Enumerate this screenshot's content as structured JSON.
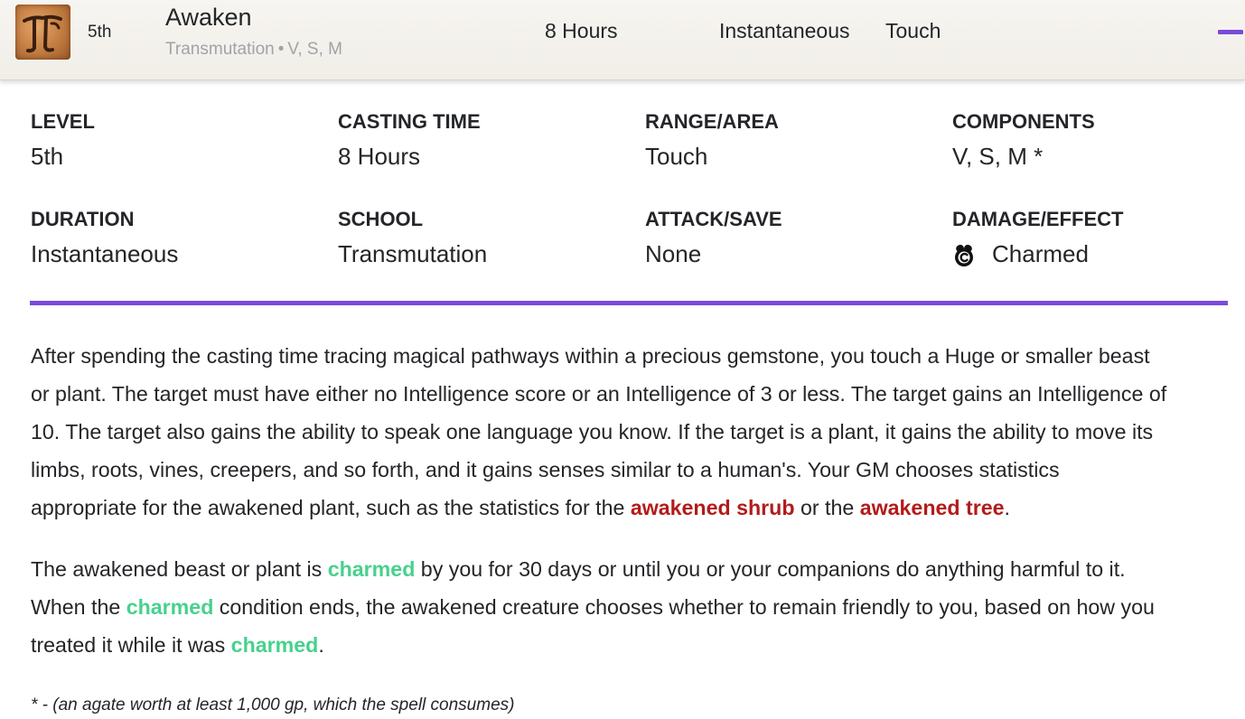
{
  "header": {
    "icon": "transmutation-school-icon",
    "level": "5th",
    "name": "Awaken",
    "school": "Transmutation",
    "separator": "•",
    "components": "V, S, M",
    "casting_time": "8 Hours",
    "duration": "Instantaneous",
    "range": "Touch",
    "accent_color": "#7a4bdb"
  },
  "stats": {
    "level": {
      "label": "LEVEL",
      "value": "5th"
    },
    "casting_time": {
      "label": "CASTING TIME",
      "value": "8 Hours"
    },
    "range": {
      "label": "RANGE/AREA",
      "value": "Touch"
    },
    "components": {
      "label": "COMPONENTS",
      "value": "V, S, M *"
    },
    "duration": {
      "label": "DURATION",
      "value": "Instantaneous"
    },
    "school": {
      "label": "SCHOOL",
      "value": "Transmutation"
    },
    "attack": {
      "label": "ATTACK/SAVE",
      "value": "None"
    },
    "damage": {
      "label": "DAMAGE/EFFECT",
      "value": "Charmed",
      "icon": "charmed-condition-icon"
    }
  },
  "description": {
    "p1": {
      "l1": "After spending the casting time tracing magical pathways within a precious gemstone, you touch a Huge or smaller beast",
      "l2": "or plant. The target must have either no Intelligence score or an Intelligence of 3 or less. The target gains an Intelligence of",
      "l3": "10. The target also gains the ability to speak one language you know. If the target is a plant, it gains the ability to move its",
      "l4": "limbs, roots, vines, creepers, and so forth, and it gains senses similar to a human's. Your GM chooses statistics",
      "l5a": "appropriate for the awakened plant, such as the statistics for the ",
      "link1": "awakened shrub",
      "l5b": " or the ",
      "link2": "awakened tree",
      "l5c": "."
    },
    "p2": {
      "l1a": "The awakened beast or plant is ",
      "link1": "charmed",
      "l1b": " by you for 30 days or until you or your companions do anything harmful to it.",
      "l2a": "When the ",
      "link2": "charmed",
      "l2b": " condition ends, the awakened creature chooses whether to remain friendly to you, based on how you",
      "l3a": "treated it while it was ",
      "link3": "charmed",
      "l3b": "."
    },
    "footnote": "* - (an agate worth at least 1,000 gp, which the spell consumes)",
    "monster_link_color": "#b31b1b",
    "condition_link_color": "#47d18c"
  }
}
